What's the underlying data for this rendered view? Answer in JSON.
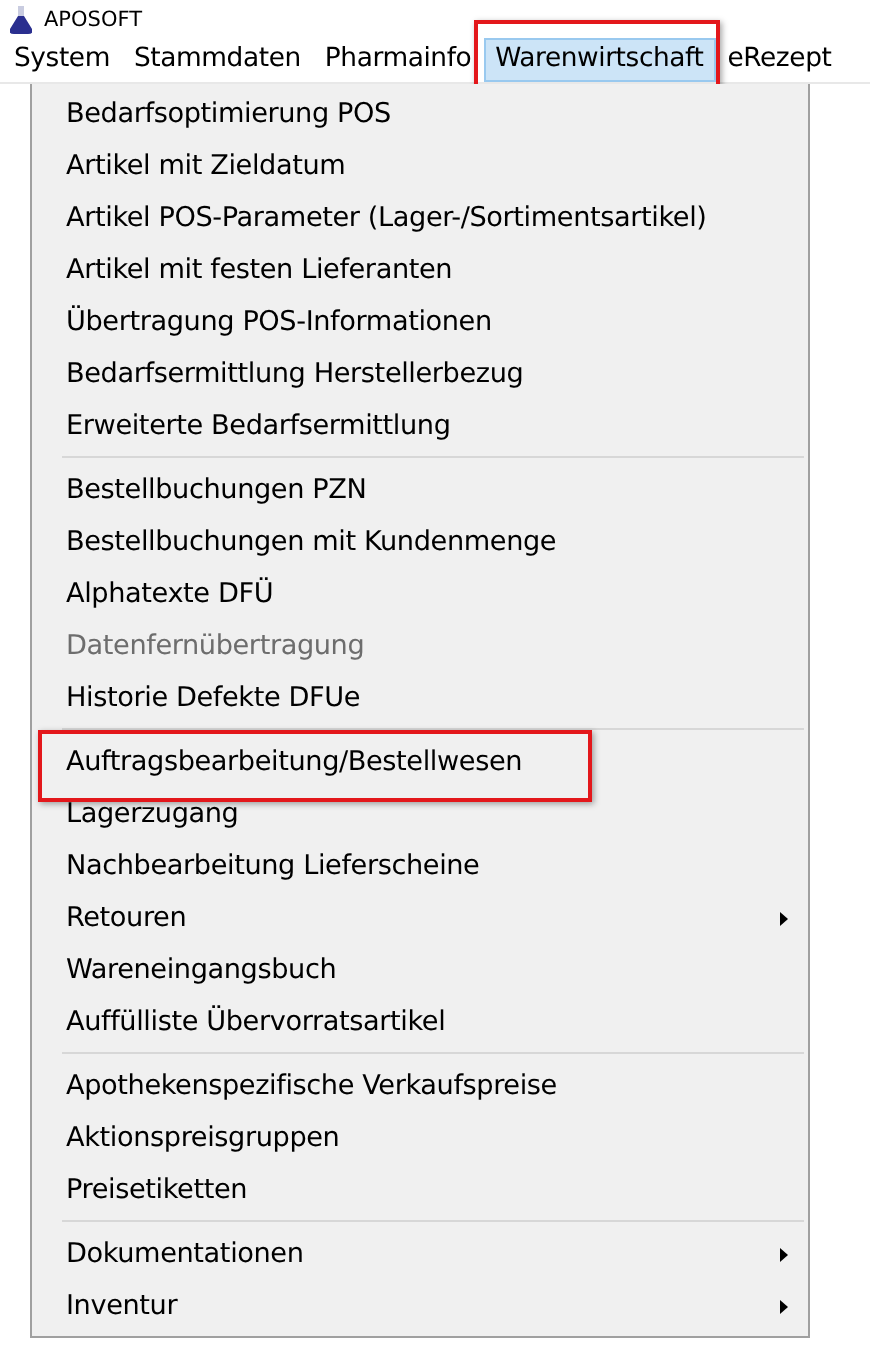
{
  "window": {
    "title": "APOSOFT"
  },
  "menubar": [
    {
      "label": "System",
      "selected": false,
      "highlighted": false
    },
    {
      "label": "Stammdaten",
      "selected": false,
      "highlighted": false
    },
    {
      "label": "Pharmainfo",
      "selected": false,
      "highlighted": false
    },
    {
      "label": "Warenwirtschaft",
      "selected": true,
      "highlighted": true
    },
    {
      "label": "eRezept",
      "selected": false,
      "highlighted": false
    }
  ],
  "menu": {
    "groups": [
      [
        {
          "label": "Bedarfsoptimierung POS",
          "disabled": false,
          "submenu": false,
          "highlighted": false
        },
        {
          "label": "Artikel mit Zieldatum",
          "disabled": false,
          "submenu": false,
          "highlighted": false
        },
        {
          "label": "Artikel POS-Parameter (Lager-/Sortimentsartikel)",
          "disabled": false,
          "submenu": false,
          "highlighted": false
        },
        {
          "label": "Artikel mit festen Lieferanten",
          "disabled": false,
          "submenu": false,
          "highlighted": false
        },
        {
          "label": "Übertragung POS-Informationen",
          "disabled": false,
          "submenu": false,
          "highlighted": false
        },
        {
          "label": "Bedarfsermittlung Herstellerbezug",
          "disabled": false,
          "submenu": false,
          "highlighted": false
        },
        {
          "label": "Erweiterte Bedarfsermittlung",
          "disabled": false,
          "submenu": false,
          "highlighted": false
        }
      ],
      [
        {
          "label": "Bestellbuchungen PZN",
          "disabled": false,
          "submenu": false,
          "highlighted": false
        },
        {
          "label": "Bestellbuchungen mit Kundenmenge",
          "disabled": false,
          "submenu": false,
          "highlighted": false
        },
        {
          "label": "Alphatexte DFÜ",
          "disabled": false,
          "submenu": false,
          "highlighted": false
        },
        {
          "label": "Datenfernübertragung",
          "disabled": true,
          "submenu": false,
          "highlighted": false
        },
        {
          "label": "Historie Defekte DFUe",
          "disabled": false,
          "submenu": false,
          "highlighted": false
        }
      ],
      [
        {
          "label": "Auftragsbearbeitung/Bestellwesen",
          "disabled": false,
          "submenu": false,
          "highlighted": true
        },
        {
          "label": "Lagerzugang",
          "disabled": false,
          "submenu": false,
          "highlighted": false
        },
        {
          "label": "Nachbearbeitung Lieferscheine",
          "disabled": false,
          "submenu": false,
          "highlighted": false
        },
        {
          "label": "Retouren",
          "disabled": false,
          "submenu": true,
          "highlighted": false
        },
        {
          "label": "Wareneingangsbuch",
          "disabled": false,
          "submenu": false,
          "highlighted": false
        },
        {
          "label": "Auffülliste Übervorratsartikel",
          "disabled": false,
          "submenu": false,
          "highlighted": false
        }
      ],
      [
        {
          "label": "Apothekenspezifische Verkaufspreise",
          "disabled": false,
          "submenu": false,
          "highlighted": false
        },
        {
          "label": "Aktionspreisgruppen",
          "disabled": false,
          "submenu": false,
          "highlighted": false
        },
        {
          "label": "Preisetiketten",
          "disabled": false,
          "submenu": false,
          "highlighted": false
        }
      ],
      [
        {
          "label": "Dokumentationen",
          "disabled": false,
          "submenu": true,
          "highlighted": false
        },
        {
          "label": "Inventur",
          "disabled": false,
          "submenu": true,
          "highlighted": false
        }
      ]
    ]
  }
}
